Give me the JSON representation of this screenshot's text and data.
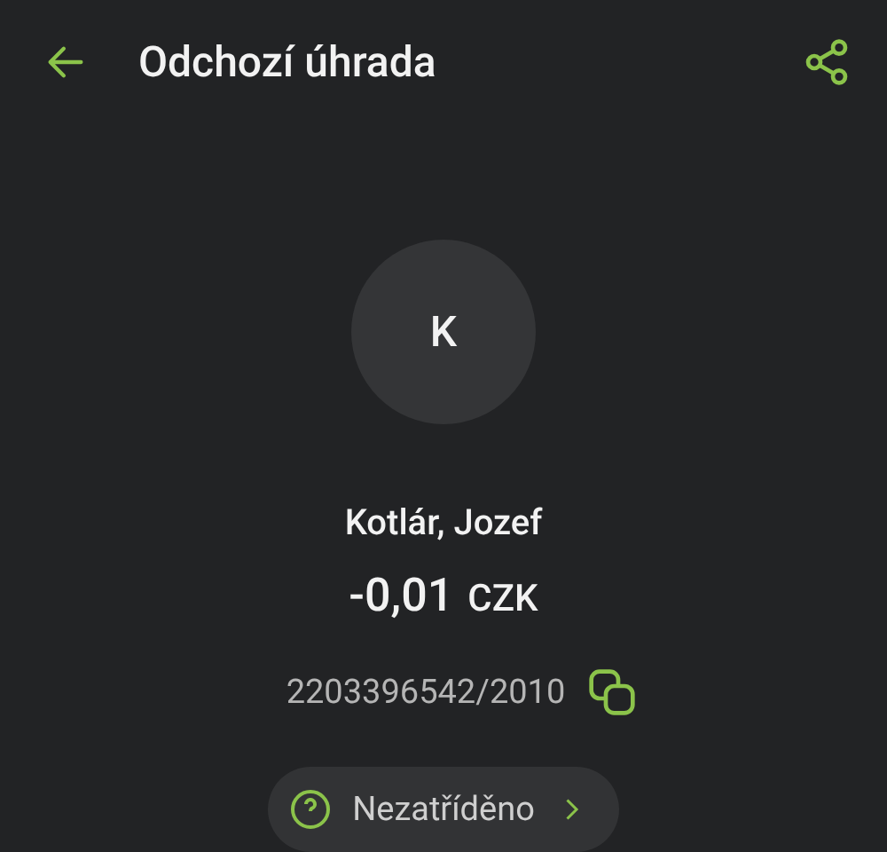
{
  "header": {
    "title": "Odchozí úhrada"
  },
  "counterparty": {
    "initial": "K",
    "name": "Kotlár, Jozef"
  },
  "amount": {
    "value": "-0,01",
    "currency": "CZK"
  },
  "account": {
    "number": "2203396542/2010"
  },
  "category": {
    "label": "Nezatříděno"
  }
}
